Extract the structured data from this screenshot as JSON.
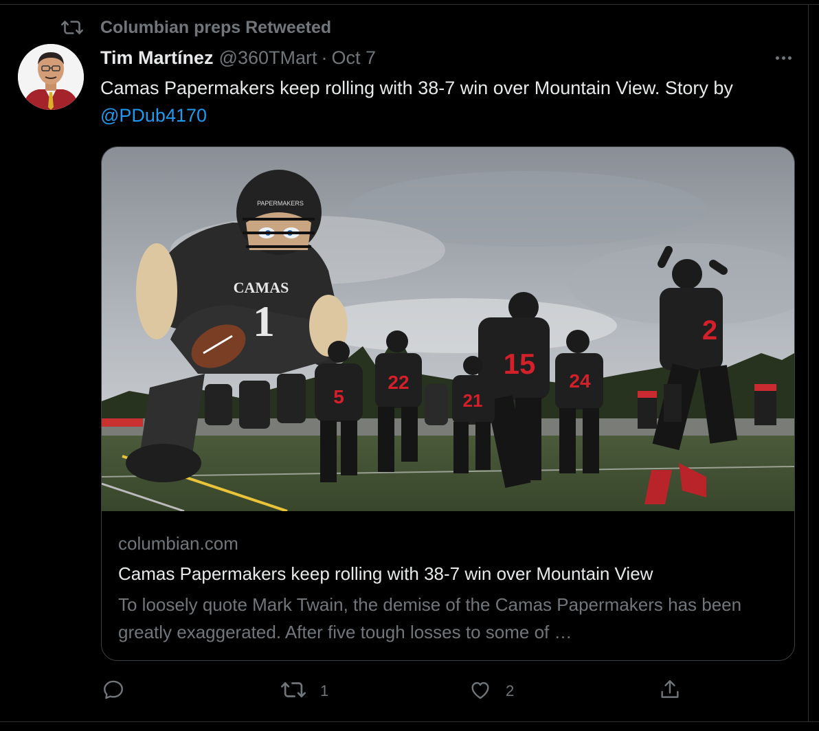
{
  "retweet_banner": {
    "text": "Columbian preps Retweeted",
    "icon": "retweet-icon"
  },
  "tweet": {
    "author_name": "Tim Martínez",
    "author_handle": "@360TMart",
    "separator": "·",
    "date": "Oct 7",
    "text_before_mention": "Camas Papermakers keep rolling with 38-7 win over Mountain View. Story by ",
    "mention": "@PDub4170",
    "more_icon": "more-horizontal-icon"
  },
  "link_card": {
    "domain": "columbian.com",
    "title": "Camas Papermakers keep rolling with 38-7 win over Mountain View",
    "description": "To loosely quote Mark Twain, the demise of the Camas Papermakers has been greatly exaggerated. After five tough losses to some of …",
    "image_text": {
      "inflatable_chest": "CAMAS",
      "inflatable_number": "1",
      "helmet_label": "PAPERMAKERS",
      "jersey_numbers": [
        "5",
        "22",
        "15",
        "21",
        "24",
        "2"
      ]
    }
  },
  "actions": {
    "reply": {
      "icon": "reply-icon",
      "count": ""
    },
    "retweet": {
      "icon": "retweet-icon",
      "count": "1"
    },
    "like": {
      "icon": "heart-icon",
      "count": "2"
    },
    "share": {
      "icon": "share-icon",
      "count": ""
    }
  },
  "colors": {
    "background": "#000000",
    "text_primary": "#e7e9ea",
    "text_secondary": "#71767b",
    "link": "#1d9bf0",
    "border": "#2f3336",
    "jersey_red": "#d3202a"
  }
}
